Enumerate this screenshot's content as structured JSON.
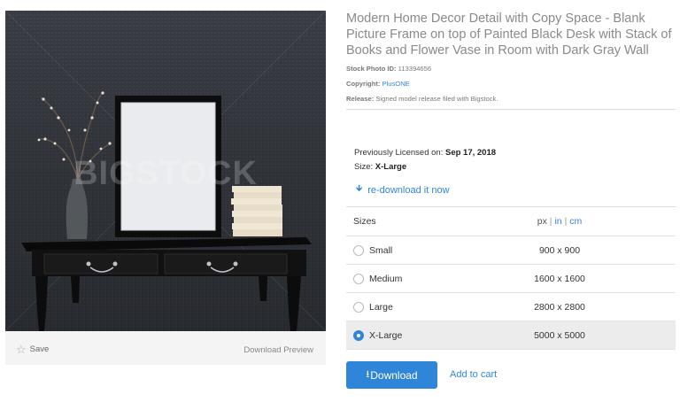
{
  "photo": {
    "watermark": "BIGSTOCK",
    "save_label": "Save",
    "download_preview_label": "Download Preview"
  },
  "details": {
    "title": "Modern Home Decor Detail with Copy Space - Blank Picture Frame on top of Painted Black Desk with Stack of Books and Flower Vase in Room with Dark Gray Wall",
    "stock_id_label": "Stock Photo ID:",
    "stock_id_value": "113394656",
    "copyright_label": "Copyright:",
    "copyright_value": "PlusONE",
    "release_label": "Release:",
    "release_value": "Signed model release filed with Bigstock."
  },
  "license": {
    "licensed_label": "Previously Licensed on:",
    "licensed_date": "Sep 17, 2018",
    "size_label": "Size:",
    "size_value": "X-Large",
    "redownload_label": "re-download it now"
  },
  "sizes": {
    "header": "Sizes",
    "units": {
      "px": "px",
      "in": "in",
      "cm": "cm",
      "sep": "|"
    },
    "rows": [
      {
        "name": "Small",
        "dims": "900 x 900"
      },
      {
        "name": "Medium",
        "dims": "1600 x 1600"
      },
      {
        "name": "Large",
        "dims": "2800 x 2800"
      },
      {
        "name": "X-Large",
        "dims": "5000 x 5000"
      }
    ],
    "selected": "X-Large"
  },
  "actions": {
    "download_label": "Download",
    "add_to_cart_label": "Add to cart"
  },
  "colors": {
    "accent": "#2f86d8",
    "selected_row_bg": "#ececec"
  }
}
